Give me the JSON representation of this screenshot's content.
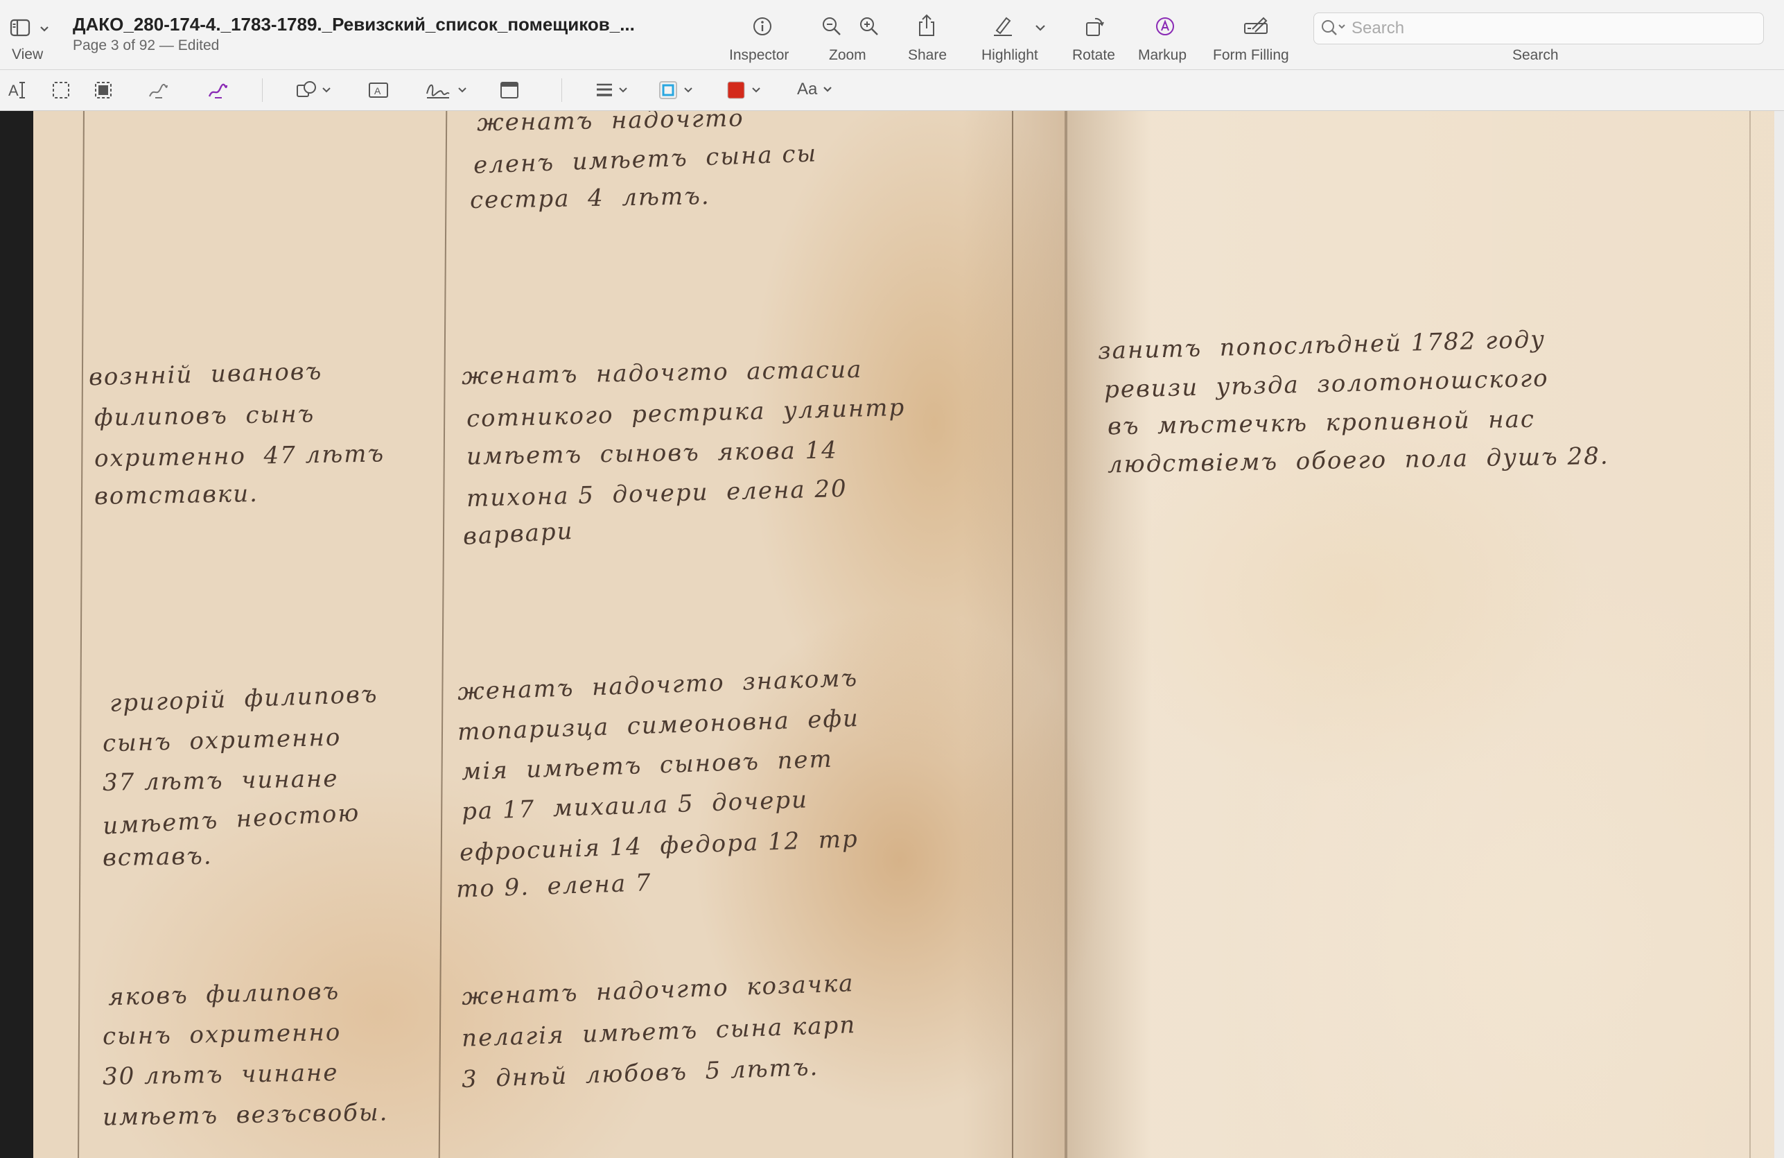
{
  "toolbar": {
    "view_label": "View",
    "title": "ДАКО_280-174-4._1783-1789._Ревизский_список_помещиков_...",
    "subtitle": "Page 3 of 92 — Edited",
    "inspector_label": "Inspector",
    "zoom_label": "Zoom",
    "share_label": "Share",
    "highlight_label": "Highlight",
    "rotate_label": "Rotate",
    "markup_label": "Markup",
    "form_filling_label": "Form Filling",
    "search_label": "Search",
    "search_placeholder": "Search"
  },
  "markup": {
    "text_style_label": "Aa",
    "border_color": "#2aa7e0",
    "fill_color": "#d32a1b",
    "signature_color": "#8a2bb5"
  },
  "document": {
    "left_col1": [
      "вознній  ивановъ",
      "филиповъ  сынъ",
      "охритенно  47 лѣтъ",
      "вотставки."
    ],
    "left_col1_b": [
      "григорій  филиповъ",
      "сынъ  охритенно",
      "37 лѣтъ  чинане",
      "имѣетъ  неостою",
      "вставъ."
    ],
    "left_col1_c": [
      "яковъ  филиповъ",
      "сынъ  охритенно",
      "30 лѣтъ  чинане",
      "имѣетъ  везъсвобы."
    ],
    "left_col2_top": [
      "женатъ  надочгто",
      "еленъ  имѣетъ  сына сы",
      "сестра  4  лѣтъ."
    ],
    "left_col2_a": [
      "женатъ  надочгто  астасиа",
      "сотникого  рестрика  уляинтр",
      "имѣетъ  сыновъ  якова 14",
      "тихона 5  дочери  елена 20",
      "варвари"
    ],
    "left_col2_b": [
      "женатъ  надочгто  знакомъ",
      "топаризца  симеоновна  ефи",
      "мія  имѣетъ  сыновъ  пет",
      "ра 17  михаила 5  дочери",
      "ефросинія 14  федора 12  тр",
      "то 9.  елена 7"
    ],
    "left_col2_c": [
      "женатъ  надочгто  козачка",
      "пелагія  имѣетъ  сына карп",
      "3  днѣй  любовъ  5 лѣтъ."
    ],
    "right_block": [
      "занитъ  попослѣдней 1782 году",
      "ревизи  уѣзда  золотоношского",
      "въ  мѣстечкѣ  кропивной  нас",
      "людствіемъ  обоего  пола  душъ 28."
    ]
  }
}
